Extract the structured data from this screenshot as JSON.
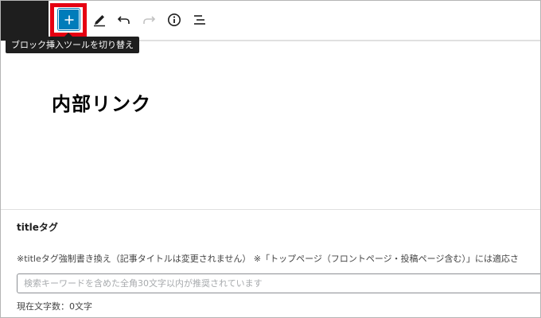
{
  "toolbar": {
    "inserter_label": "+",
    "tooltip": "ブロック挿入ツールを切り替え",
    "icons": [
      "plus-icon",
      "pencil-icon",
      "undo-icon",
      "redo-icon",
      "info-icon",
      "list-view-icon"
    ],
    "accent_color": "#007cba",
    "highlight_color": "#e60012"
  },
  "editor": {
    "post_title": "内部リンク"
  },
  "meta": {
    "label": "titleタグ",
    "description": "※titleタグ強制書き換え（記事タイトルは変更されません） ※「トップページ（フロントページ・投稿ページ含む）」には適応さ",
    "input_value": "",
    "input_placeholder": "検索キーワードを含めた全角30文字以内が推奨されています",
    "char_count": "現在文字数：0文字"
  }
}
